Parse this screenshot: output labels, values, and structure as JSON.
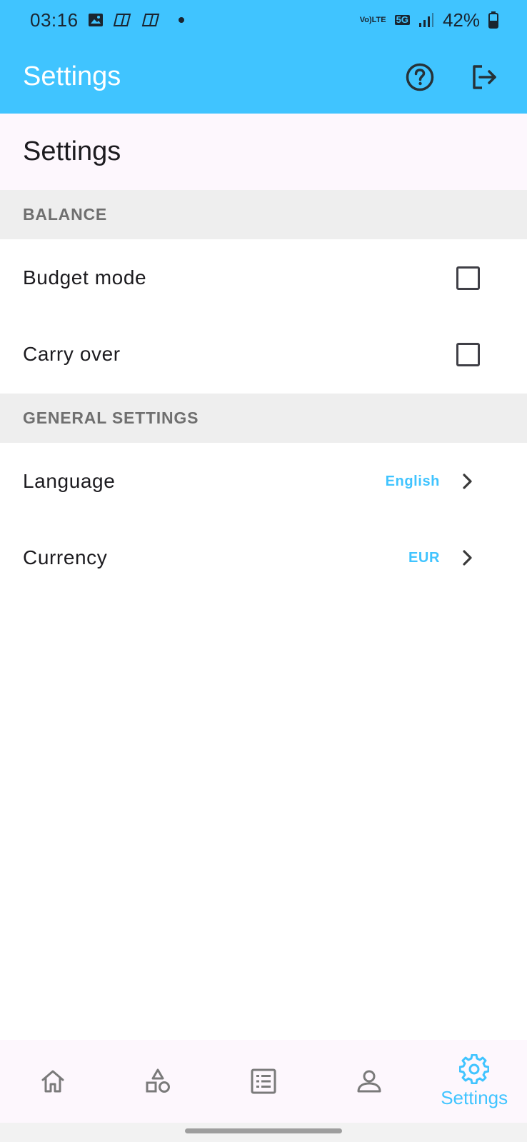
{
  "status_bar": {
    "time": "03:16",
    "network": "5G",
    "volte_top": "Vo)",
    "volte_bottom": "LTE",
    "battery": "42%"
  },
  "app_bar": {
    "title": "Settings",
    "actions": [
      "help-icon",
      "logout-icon"
    ]
  },
  "page": {
    "heading": "Settings"
  },
  "sections": {
    "balance": {
      "header": "BALANCE",
      "items": [
        {
          "label": "Budget mode",
          "checked": false
        },
        {
          "label": "Carry over",
          "checked": false
        }
      ]
    },
    "general": {
      "header": "GENERAL SETTINGS",
      "items": [
        {
          "label": "Language",
          "value": "English"
        },
        {
          "label": "Currency",
          "value": "EUR"
        }
      ]
    }
  },
  "bottom_nav": {
    "items": [
      {
        "icon": "home-icon",
        "label": ""
      },
      {
        "icon": "categories-icon",
        "label": ""
      },
      {
        "icon": "list-icon",
        "label": ""
      },
      {
        "icon": "profile-icon",
        "label": ""
      },
      {
        "icon": "gear-icon",
        "label": "Settings",
        "active": true
      }
    ]
  },
  "colors": {
    "accent": "#40c4ff",
    "section_bg": "#eeeeee",
    "heading_bg": "#fdf7fd"
  }
}
